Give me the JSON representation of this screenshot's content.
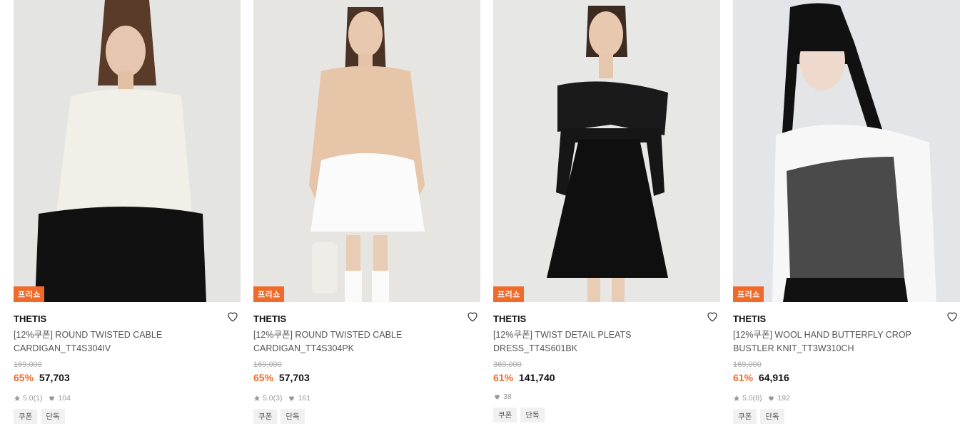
{
  "products": [
    {
      "badge": "프리쇼",
      "brand": "THETIS",
      "name": "[12%쿠폰] ROUND TWISTED CABLE CARDIGAN_TT4S304IV",
      "original_price": "169,000",
      "discount": "65%",
      "price": "57,703",
      "rating": "5.0",
      "review_count": "(1)",
      "likes": "104",
      "tags": [
        "쿠폰",
        "단독"
      ],
      "image_desc": "model in ivory cable cardigan and black skirt"
    },
    {
      "badge": "프리쇼",
      "brand": "THETIS",
      "name": "[12%쿠폰] ROUND TWISTED CABLE CARDIGAN_TT4S304PK",
      "original_price": "169,000",
      "discount": "65%",
      "price": "57,703",
      "rating": "5.0",
      "review_count": "(3)",
      "likes": "161",
      "tags": [
        "쿠폰",
        "단독"
      ],
      "image_desc": "model in pink cable cardigan and white tulle skirt"
    },
    {
      "badge": "프리쇼",
      "brand": "THETIS",
      "name": "[12%쿠폰] TWIST DETAIL PLEATS DRESS_TT4S601BK",
      "original_price": "369,000",
      "discount": "61%",
      "price": "141,740",
      "rating": "",
      "review_count": "",
      "likes": "38",
      "tags": [
        "쿠폰",
        "단독"
      ],
      "image_desc": "model in black off-shoulder dress"
    },
    {
      "badge": "프리쇼",
      "brand": "THETIS",
      "name": "[12%쿠폰] WOOL HAND BUTTERFLY CROP BUSTLER KNIT_TT3W310CH",
      "original_price": "169,000",
      "discount": "61%",
      "price": "64,916",
      "rating": "5.0",
      "review_count": "(8)",
      "likes": "192",
      "tags": [
        "쿠폰",
        "단독"
      ],
      "image_desc": "model in grey bustier knit over white shirt"
    }
  ],
  "colors": {
    "accent": "#f26a2a",
    "badge_bg": "#f26a2a",
    "tag_bg": "#f1f1f1"
  }
}
